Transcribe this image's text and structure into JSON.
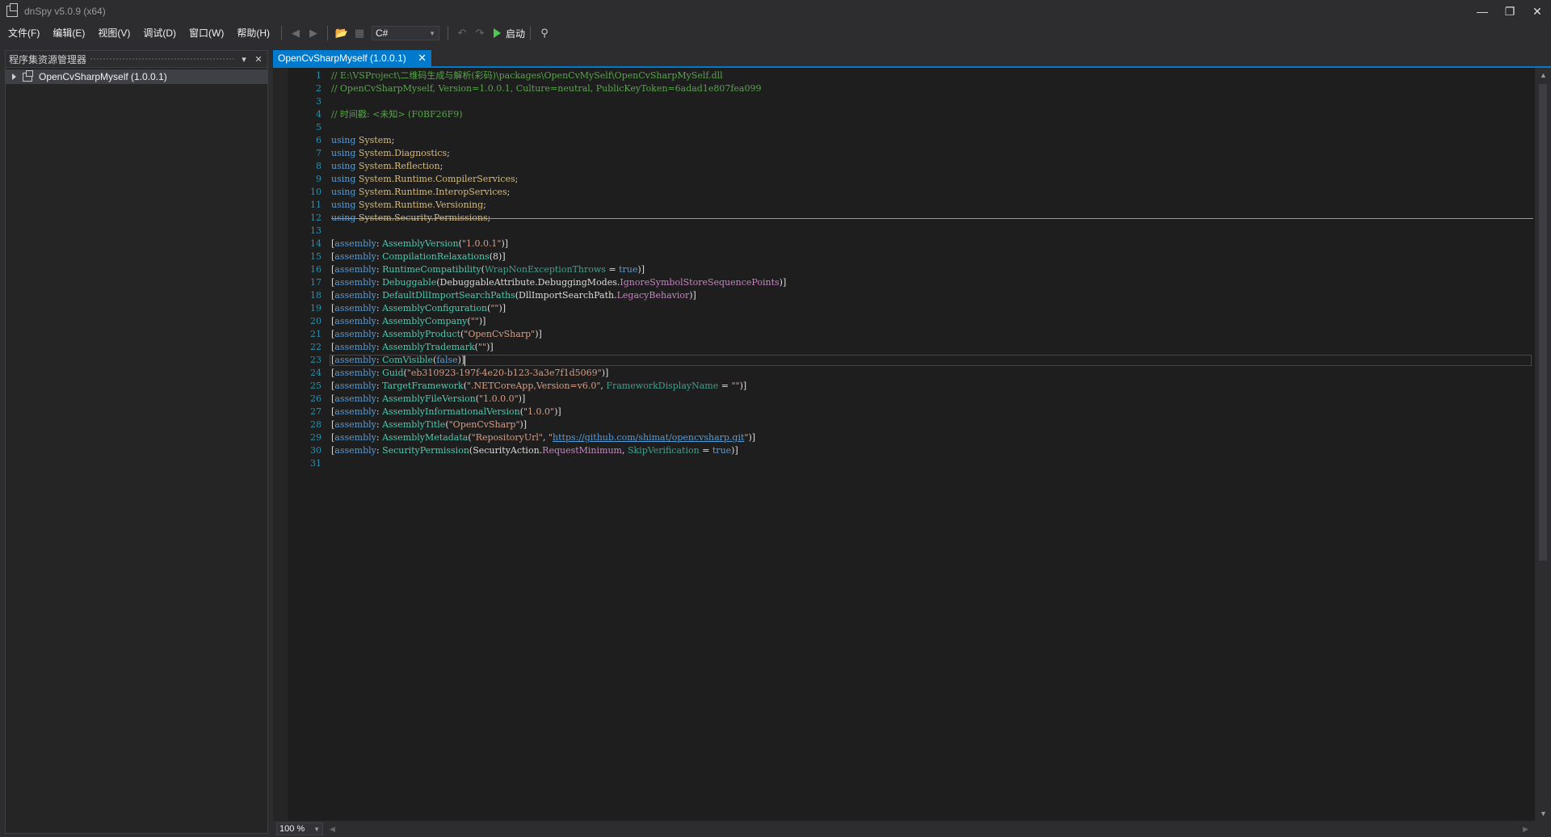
{
  "window": {
    "title": "dnSpy v5.0.9 (x64)"
  },
  "menu": [
    "文件(F)",
    "编辑(E)",
    "视图(V)",
    "调试(D)",
    "窗口(W)",
    "帮助(H)"
  ],
  "toolbar": {
    "language": "C#",
    "run_label": "启动"
  },
  "assembly_explorer": {
    "title": "程序集资源管理器",
    "items": [
      {
        "label": "OpenCvSharpMyself (1.0.0.1)"
      }
    ]
  },
  "tab": {
    "label": "OpenCvSharpMyself (1.0.0.1)"
  },
  "editor": {
    "zoom": "100 %",
    "current_line": 23,
    "lines": [
      [
        [
          "// E:\\VSProject\\二维码生成与解析(彩码)\\packages\\OpenCvMySelf\\OpenCvSharpMySelf.dll",
          "com"
        ]
      ],
      [
        [
          "// OpenCvSharpMyself, Version=1.0.0.1, Culture=neutral, PublicKeyToken=6adad1e807fea099",
          "com"
        ]
      ],
      [],
      [
        [
          "// 时间戳: <未知> (F0BF26F9)",
          "com"
        ]
      ],
      [],
      [
        [
          "using",
          "kw"
        ],
        [
          " ",
          "plain"
        ],
        [
          "System",
          "ns"
        ],
        [
          ";",
          "plain"
        ]
      ],
      [
        [
          "using",
          "kw"
        ],
        [
          " ",
          "plain"
        ],
        [
          "System.Diagnostics",
          "ns"
        ],
        [
          ";",
          "plain"
        ]
      ],
      [
        [
          "using",
          "kw"
        ],
        [
          " ",
          "plain"
        ],
        [
          "System.Reflection",
          "ns"
        ],
        [
          ";",
          "plain"
        ]
      ],
      [
        [
          "using",
          "kw"
        ],
        [
          " ",
          "plain"
        ],
        [
          "System.Runtime.CompilerServices",
          "ns"
        ],
        [
          ";",
          "plain"
        ]
      ],
      [
        [
          "using",
          "kw"
        ],
        [
          " ",
          "plain"
        ],
        [
          "System.Runtime.InteropServices",
          "ns"
        ],
        [
          ";",
          "plain"
        ]
      ],
      [
        [
          "using",
          "kw"
        ],
        [
          " ",
          "plain"
        ],
        [
          "System.Runtime.Versioning",
          "ns"
        ],
        [
          ";",
          "plain"
        ]
      ],
      [
        [
          "using",
          "kw"
        ],
        [
          " ",
          "plain"
        ],
        [
          "System.Security.Permissions",
          "ns"
        ],
        [
          ";",
          "plain"
        ]
      ],
      [],
      [
        [
          "[",
          "plain"
        ],
        [
          "assembly",
          "kw"
        ],
        [
          ": ",
          "plain"
        ],
        [
          "AssemblyVersion",
          "type"
        ],
        [
          "(",
          "plain"
        ],
        [
          "\"1.0.0.1\"",
          "str"
        ],
        [
          ")]",
          "plain"
        ]
      ],
      [
        [
          "[",
          "plain"
        ],
        [
          "assembly",
          "kw"
        ],
        [
          ": ",
          "plain"
        ],
        [
          "CompilationRelaxations",
          "type"
        ],
        [
          "(8)]",
          "plain"
        ]
      ],
      [
        [
          "[",
          "plain"
        ],
        [
          "assembly",
          "kw"
        ],
        [
          ": ",
          "plain"
        ],
        [
          "RuntimeCompatibility",
          "type"
        ],
        [
          "(",
          "plain"
        ],
        [
          "WrapNonExceptionThrows",
          "prop"
        ],
        [
          " = ",
          "plain"
        ],
        [
          "true",
          "kw"
        ],
        [
          ")]",
          "plain"
        ]
      ],
      [
        [
          "[",
          "plain"
        ],
        [
          "assembly",
          "kw"
        ],
        [
          ": ",
          "plain"
        ],
        [
          "Debuggable",
          "type"
        ],
        [
          "(",
          "plain"
        ],
        [
          "DebuggableAttribute.DebuggingModes",
          "plain"
        ],
        [
          ".",
          "plain"
        ],
        [
          "IgnoreSymbolStoreSequencePoints",
          "field"
        ],
        [
          ")]",
          "plain"
        ]
      ],
      [
        [
          "[",
          "plain"
        ],
        [
          "assembly",
          "kw"
        ],
        [
          ": ",
          "plain"
        ],
        [
          "DefaultDllImportSearchPaths",
          "type"
        ],
        [
          "(",
          "plain"
        ],
        [
          "DllImportSearchPath",
          "plain"
        ],
        [
          ".",
          "plain"
        ],
        [
          "LegacyBehavior",
          "field"
        ],
        [
          ")]",
          "plain"
        ]
      ],
      [
        [
          "[",
          "plain"
        ],
        [
          "assembly",
          "kw"
        ],
        [
          ": ",
          "plain"
        ],
        [
          "AssemblyConfiguration",
          "type"
        ],
        [
          "(",
          "plain"
        ],
        [
          "\"\"",
          "str"
        ],
        [
          ")]",
          "plain"
        ]
      ],
      [
        [
          "[",
          "plain"
        ],
        [
          "assembly",
          "kw"
        ],
        [
          ": ",
          "plain"
        ],
        [
          "AssemblyCompany",
          "type"
        ],
        [
          "(",
          "plain"
        ],
        [
          "\"\"",
          "str"
        ],
        [
          ")]",
          "plain"
        ]
      ],
      [
        [
          "[",
          "plain"
        ],
        [
          "assembly",
          "kw"
        ],
        [
          ": ",
          "plain"
        ],
        [
          "AssemblyProduct",
          "type"
        ],
        [
          "(",
          "plain"
        ],
        [
          "\"OpenCvSharp\"",
          "str"
        ],
        [
          ")]",
          "plain"
        ]
      ],
      [
        [
          "[",
          "plain"
        ],
        [
          "assembly",
          "kw"
        ],
        [
          ": ",
          "plain"
        ],
        [
          "AssemblyTrademark",
          "type"
        ],
        [
          "(",
          "plain"
        ],
        [
          "\"\"",
          "str"
        ],
        [
          ")]",
          "plain"
        ]
      ],
      [
        [
          "[",
          "plain"
        ],
        [
          "assembly",
          "kw"
        ],
        [
          ": ",
          "plain"
        ],
        [
          "ComVisible",
          "type"
        ],
        [
          "(",
          "plain"
        ],
        [
          "false",
          "kw"
        ],
        [
          ")]",
          "plain"
        ]
      ],
      [
        [
          "[",
          "plain"
        ],
        [
          "assembly",
          "kw"
        ],
        [
          ": ",
          "plain"
        ],
        [
          "Guid",
          "type"
        ],
        [
          "(",
          "plain"
        ],
        [
          "\"eb310923-197f-4e20-b123-3a3e7f1d5069\"",
          "str"
        ],
        [
          ")]",
          "plain"
        ]
      ],
      [
        [
          "[",
          "plain"
        ],
        [
          "assembly",
          "kw"
        ],
        [
          ": ",
          "plain"
        ],
        [
          "TargetFramework",
          "type"
        ],
        [
          "(",
          "plain"
        ],
        [
          "\".NETCoreApp,Version=v6.0\"",
          "str"
        ],
        [
          ", ",
          "plain"
        ],
        [
          "FrameworkDisplayName",
          "prop"
        ],
        [
          " = ",
          "plain"
        ],
        [
          "\"\"",
          "str"
        ],
        [
          ")]",
          "plain"
        ]
      ],
      [
        [
          "[",
          "plain"
        ],
        [
          "assembly",
          "kw"
        ],
        [
          ": ",
          "plain"
        ],
        [
          "AssemblyFileVersion",
          "type"
        ],
        [
          "(",
          "plain"
        ],
        [
          "\"1.0.0.0\"",
          "str"
        ],
        [
          ")]",
          "plain"
        ]
      ],
      [
        [
          "[",
          "plain"
        ],
        [
          "assembly",
          "kw"
        ],
        [
          ": ",
          "plain"
        ],
        [
          "AssemblyInformationalVersion",
          "type"
        ],
        [
          "(",
          "plain"
        ],
        [
          "\"1.0.0\"",
          "str"
        ],
        [
          ")]",
          "plain"
        ]
      ],
      [
        [
          "[",
          "plain"
        ],
        [
          "assembly",
          "kw"
        ],
        [
          ": ",
          "plain"
        ],
        [
          "AssemblyTitle",
          "type"
        ],
        [
          "(",
          "plain"
        ],
        [
          "\"OpenCvSharp\"",
          "str"
        ],
        [
          ")]",
          "plain"
        ]
      ],
      [
        [
          "[",
          "plain"
        ],
        [
          "assembly",
          "kw"
        ],
        [
          ": ",
          "plain"
        ],
        [
          "AssemblyMetadata",
          "type"
        ],
        [
          "(",
          "plain"
        ],
        [
          "\"RepositoryUrl\"",
          "str"
        ],
        [
          ", ",
          "plain"
        ],
        [
          "\"",
          "str"
        ],
        [
          "https://github.com/shimat/opencvsharp.git",
          "link"
        ],
        [
          "\"",
          "str"
        ],
        [
          ")]",
          "plain"
        ]
      ],
      [
        [
          "[",
          "plain"
        ],
        [
          "assembly",
          "kw"
        ],
        [
          ": ",
          "plain"
        ],
        [
          "SecurityPermission",
          "type"
        ],
        [
          "(",
          "plain"
        ],
        [
          "SecurityAction",
          "plain"
        ],
        [
          ".",
          "plain"
        ],
        [
          "RequestMinimum",
          "field"
        ],
        [
          ", ",
          "plain"
        ],
        [
          "SkipVerification",
          "prop"
        ],
        [
          " = ",
          "plain"
        ],
        [
          "true",
          "kw"
        ],
        [
          ")]",
          "plain"
        ]
      ],
      []
    ]
  }
}
